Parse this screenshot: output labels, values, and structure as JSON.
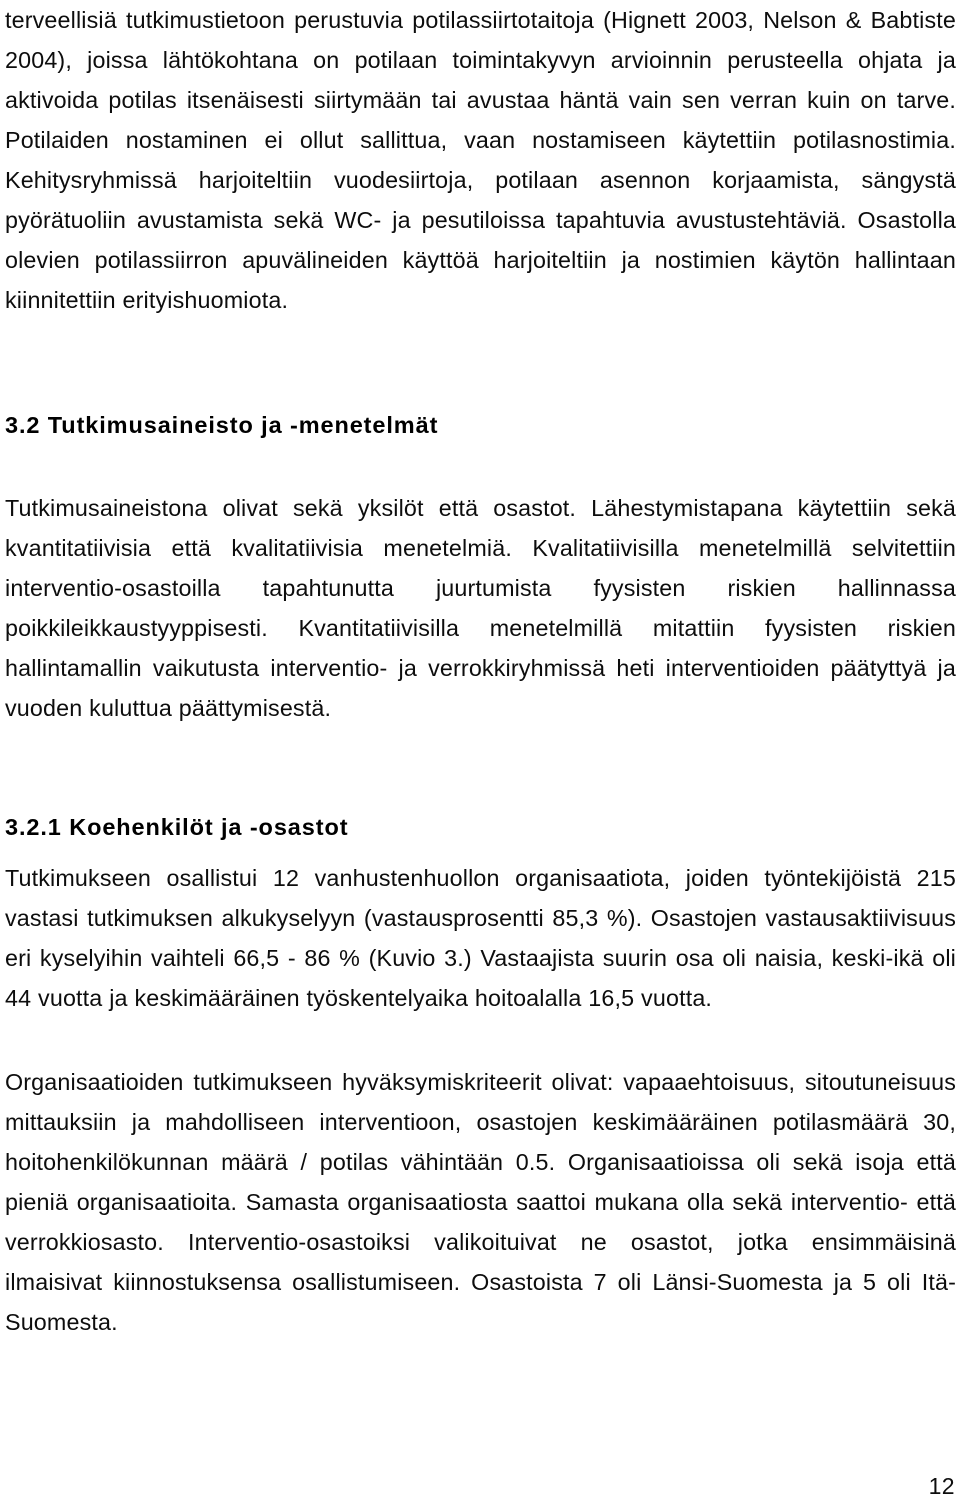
{
  "document": {
    "language": "fi",
    "page_number": "12",
    "text_color": "#0d0d0d",
    "background_color": "#ffffff"
  },
  "body": {
    "paragraph_1_continued": "terveellisiä tutkimustietoon perustuvia potilassiirtotaitoja (Hignett 2003, Nelson & Babtiste 2004), joissa lähtökohtana on potilaan toimintakyvyn arvioinnin perusteella ohjata ja aktivoida potilas itsenäisesti siirtymään tai avustaa häntä vain sen verran kuin on tarve. Potilaiden nostaminen ei ollut sallittua, vaan nostamiseen käytettiin potilasnostimia. Kehitysryhmissä harjoiteltiin vuodesiirtoja, potilaan asennon korjaamista, sängystä pyörätuoliin avustamista sekä WC- ja pesutiloissa tapahtuvia avustustehtäviä. Osastolla olevien potilassiirron apuvälineiden käyttöä harjoiteltiin ja nostimien käytön hallintaan kiinnitettiin erityishuomiota.",
    "heading_3_2": "3.2 Tutkimusaineisto ja -menetelmät",
    "paragraph_2": "Tutkimusaineistona olivat sekä yksilöt että osastot. Lähestymistapana käytettiin sekä kvantitatiivisia että kvalitatiivisia menetelmiä. Kvalitatiivisilla menetelmillä selvitettiin interventio-osastoilla tapahtunutta juurtumista fyysisten riskien hallinnassa poikkileikkaustyyppisesti. Kvantitatiivisilla menetelmillä mitattiin fyysisten riskien hallintamallin vaikutusta interventio- ja verrokkiryhmissä heti interventioiden päätyttyä ja vuoden kuluttua päättymisestä.",
    "heading_3_2_1": "3.2.1 Koehenkilöt ja -osastot",
    "paragraph_3": "Tutkimukseen osallistui 12 vanhustenhuollon organisaatiota, joiden työntekijöistä 215 vastasi tutkimuksen alkukyselyyn (vastausprosentti 85,3 %). Osastojen vastausaktiivisuus eri kyselyihin vaihteli 66,5 - 86 % (Kuvio 3.) Vastaajista suurin osa oli naisia, keski-ikä oli 44 vuotta ja keskimääräinen työskentelyaika hoitoalalla 16,5 vuotta.",
    "paragraph_4": "Organisaatioiden tutkimukseen hyväksymiskriteerit olivat: vapaaehtoisuus, sitoutuneisuus mittauksiin ja mahdolliseen interventioon, osastojen keskimääräinen potilasmäärä 30, hoitohenkilökunnan määrä / potilas vähintään 0.5. Organisaatioissa oli sekä isoja että pieniä organisaatioita. Samasta organisaatiosta saattoi mukana olla sekä interventio- että verrokkiosasto. Interventio-osastoiksi valikoituivat ne osastot, jotka ensimmäisinä ilmaisivat kiinnostuksensa osallistumiseen. Osastoista 7 oli Länsi-Suomesta ja 5 oli Itä-Suomesta."
  }
}
